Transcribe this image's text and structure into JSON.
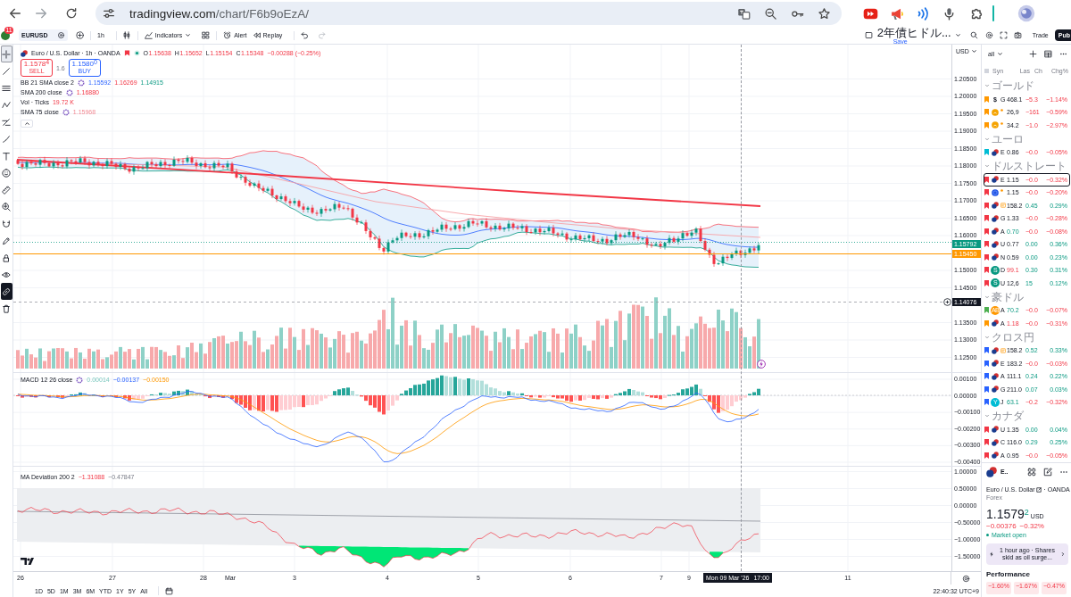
{
  "browser": {
    "url_host": "tradingview.com",
    "url_path": "/chart/F6b9oEzA/"
  },
  "toolbar": {
    "notifications": "11",
    "symbol": "EURUSD",
    "interval": "1h",
    "indicators": "Indicators",
    "alert": "Alert",
    "replay": "Replay",
    "layout_name": "2年債ヒドル...",
    "layout_status": "Save",
    "trade": "Trade",
    "publish": "Pub"
  },
  "drawing_tools": [
    {
      "selected": true,
      "on": false
    },
    {
      "selected": false,
      "on": false
    },
    {
      "selected": false,
      "on": false
    },
    {
      "selected": false,
      "on": false
    },
    {
      "selected": false,
      "on": false
    },
    {
      "selected": false,
      "on": false
    },
    {
      "selected": false,
      "on": false
    },
    {
      "selected": false,
      "on": false
    },
    {
      "selected": false,
      "on": false
    },
    {
      "selected": false,
      "on": false
    },
    {
      "selected": false,
      "on": false
    },
    {
      "selected": false,
      "on": false
    },
    {
      "selected": false,
      "on": false
    },
    {
      "selected": false,
      "on": false
    },
    {
      "selected": false,
      "on": true
    },
    {
      "selected": false,
      "on": false
    }
  ],
  "legend": {
    "title": "Euro / U.S. Dollar · 1h · OANDA",
    "falling": true,
    "ohlc": [
      {
        "label": "O",
        "value": "1.15638"
      },
      {
        "label": "H",
        "value": "1.15652"
      },
      {
        "label": "L",
        "value": "1.15154"
      },
      {
        "label": "C",
        "value": "1.15348"
      }
    ],
    "change": "−0.00288 (−0.25%)",
    "sell": {
      "price": "1.1578$^{4}$",
      "label": "SELL"
    },
    "spread": "1.6",
    "buy": {
      "price": "1.1580$^{0}$",
      "label": "BUY"
    },
    "studies": [
      {
        "kind": "ringed",
        "name": "BB 21 SMA close 2",
        "values": [
          "1.15592",
          "1.16269",
          "1.14915"
        ]
      },
      {
        "kind": "ringed",
        "name": "SMA 200 close",
        "values": [
          "1.16880"
        ]
      },
      {
        "kind": "plain",
        "name": "Vol · Ticks",
        "values": [
          "19.72 K"
        ]
      },
      {
        "kind": "ringed",
        "name": "SMA 75 close",
        "values": [
          "1.15968"
        ]
      }
    ]
  },
  "macd_legend": {
    "kind": "ringed",
    "name": "MACD 12 26 close",
    "values": [
      "0.00014",
      "−0.00137",
      "−0.00150"
    ]
  },
  "deviation_legend": {
    "name": "MA Deviation 200 2",
    "values": [
      "−1.31088",
      "−0.47847"
    ]
  },
  "price_axis": {
    "currency": "USD",
    "ticks": [
      "1.20500",
      "1.20000",
      "1.19500",
      "1.19000",
      "1.18500",
      "1.18000",
      "1.17500",
      "1.17000",
      "1.16500",
      "1.16000",
      "1.15000",
      "1.14500",
      "1.13500",
      "1.13000",
      "1.12500"
    ],
    "markers": [
      {
        "kind": "last",
        "text": "1.15792"
      },
      {
        "kind": "line",
        "text": "1.15450"
      },
      {
        "kind": "crosshair",
        "text": "1.14076"
      }
    ]
  },
  "macd_axis": {
    "ticks": [
      "0.00100",
      "0.00000",
      "−0.00100",
      "−0.00200",
      "−0.00300",
      "−0.00400"
    ]
  },
  "deviation_axis": {
    "ticks": [
      "1.00000",
      "0.50000",
      "0.00000",
      "−0.50000",
      "−1.00000",
      "−1.50000"
    ]
  },
  "time_axis": {
    "ticks": [
      "26",
      "27",
      "28",
      "Mar",
      "3",
      "4",
      "5",
      "6",
      "7",
      "9",
      "11"
    ],
    "crosshair_date": "Mon 09 Mar '26",
    "crosshair_time": "17:00"
  },
  "bottom_bar": {
    "ranges": [
      "1D",
      "5D",
      "1M",
      "3M",
      "6M",
      "YTD",
      "1Y",
      "5Y",
      "All"
    ],
    "clock": "22:40:32 UTC+9"
  },
  "watchlist": {
    "filter": "all",
    "columns": [
      "Syn",
      "Las",
      "Ch",
      "Chg%"
    ],
    "sections": [
      {
        "title": "ゴールド",
        "expanded": true,
        "rows": [
          {
            "color": "#ff9800",
            "icon": {
              "kind": "glyph",
              "text": "$"
            },
            "symbol": "G",
            "last": "468.1",
            "last_rising": false,
            "last_falling": false,
            "change": "−5.3",
            "change_pct": "−1.14%",
            "negative": true,
            "selected": false
          },
          {
            "color": "#ff9800",
            "icon": {
              "kind": "coin"
            },
            "badge": {
              "kind": "dot"
            },
            "last": "26,9",
            "last_rising": false,
            "last_falling": false,
            "change": "−161",
            "change_pct": "−0.59%",
            "negative": true,
            "selected": false
          },
          {
            "color": "#ff9800",
            "icon": {
              "kind": "coin"
            },
            "badge": {
              "kind": "dot"
            },
            "last": "34.2",
            "last_rising": false,
            "last_falling": false,
            "change": "−1.0",
            "change_pct": "−2.97%",
            "negative": true,
            "selected": false
          }
        ]
      },
      {
        "title": "ユーロ",
        "expanded": true,
        "rows": [
          {
            "color": "#00bcd4",
            "icon": {
              "kind": "pair"
            },
            "symbol": "E",
            "last": "0.86",
            "last_rising": false,
            "last_falling": false,
            "change": "−0.0",
            "change_pct": "−0.05%",
            "negative": true,
            "selected": false
          }
        ]
      },
      {
        "title": "ドルストレート",
        "expanded": true,
        "rows": [
          {
            "color": "#f23645",
            "icon": {
              "kind": "pair"
            },
            "symbol": "E",
            "last": "1.15",
            "last_rising": false,
            "last_falling": false,
            "change": "−0.0",
            "change_pct": "−0.32%",
            "negative": true,
            "selected": true
          },
          {
            "color": "#f23645",
            "icon": {
              "kind": "globe"
            },
            "badge": {
              "kind": "dot"
            },
            "last": "1.15",
            "last_rising": false,
            "last_falling": false,
            "change": "−0.0",
            "change_pct": "−0.20%",
            "negative": true,
            "selected": false
          },
          {
            "color": "#f23645",
            "icon": {
              "kind": "pair"
            },
            "badge": {
              "kind": "news"
            },
            "last": "158.2",
            "last_rising": false,
            "last_falling": false,
            "change": "0.45",
            "change_pct": "0.29%",
            "negative": false,
            "selected": false
          },
          {
            "color": "#f23645",
            "icon": {
              "kind": "pair"
            },
            "symbol": "G",
            "last": "1.33",
            "last_rising": false,
            "last_falling": false,
            "change": "−0.0",
            "change_pct": "−0.28%",
            "negative": true,
            "selected": false
          },
          {
            "color": "#f23645",
            "icon": {
              "kind": "pair"
            },
            "symbol": "A",
            "last": "0.70",
            "last_rising": true,
            "last_falling": false,
            "change": "−0.0",
            "change_pct": "−0.08%",
            "negative": true,
            "selected": false
          },
          {
            "color": "#f23645",
            "icon": {
              "kind": "pair"
            },
            "symbol": "U",
            "last": "0.77",
            "last_rising": false,
            "last_falling": false,
            "change": "0.00",
            "change_pct": "0.36%",
            "negative": false,
            "selected": false
          },
          {
            "color": "#f23645",
            "icon": {
              "kind": "pair"
            },
            "symbol": "N",
            "last": "0.59",
            "last_rising": false,
            "last_falling": false,
            "change": "0.00",
            "change_pct": "0.23%",
            "negative": false,
            "selected": false
          },
          {
            "color": "#f23645",
            "icon": {
              "kind": "letter",
              "text": "S",
              "color": "#089981"
            },
            "symbol": "D",
            "last": "99.1",
            "last_rising": false,
            "last_falling": true,
            "change": "0.30",
            "change_pct": "0.31%",
            "negative": false,
            "selected": false
          },
          {
            "color": "#f23645",
            "icon": {
              "kind": "letter",
              "text": "S",
              "color": "#089981"
            },
            "symbol": "U",
            "last": "12,6",
            "last_rising": false,
            "last_falling": false,
            "change": "15",
            "change_pct": "0.12%",
            "negative": false,
            "selected": false
          }
        ]
      },
      {
        "title": "豪ドル",
        "expanded": true,
        "rows": [
          {
            "color": "#4caf50",
            "icon": {
              "kind": "letter",
              "text": "AB",
              "color": "#ff9800"
            },
            "symbol": "A",
            "last": "70.2",
            "last_rising": true,
            "last_falling": false,
            "change": "−0.0",
            "change_pct": "−0.07%",
            "negative": true,
            "selected": false
          },
          {
            "color": "#ff9800",
            "icon": {
              "kind": "pair"
            },
            "symbol": "A",
            "last": "1.18",
            "last_rising": false,
            "last_falling": true,
            "change": "−0.0",
            "change_pct": "−0.31%",
            "negative": true,
            "selected": false
          }
        ]
      },
      {
        "title": "クロス円",
        "expanded": true,
        "rows": [
          {
            "color": "#2962ff",
            "icon": {
              "kind": "pair"
            },
            "badge": {
              "kind": "news"
            },
            "last": "158.2",
            "last_rising": false,
            "last_falling": false,
            "change": "0.52",
            "change_pct": "0.33%",
            "negative": false,
            "selected": false
          },
          {
            "color": "#2962ff",
            "icon": {
              "kind": "pair"
            },
            "symbol": "E",
            "last": "183.2",
            "last_rising": false,
            "last_falling": false,
            "change": "−0.0",
            "change_pct": "−0.03%",
            "negative": true,
            "selected": false
          },
          {
            "color": "#2962ff",
            "icon": {
              "kind": "pair"
            },
            "symbol": "A",
            "last": "111.1",
            "last_rising": false,
            "last_falling": false,
            "change": "0.24",
            "change_pct": "0.22%",
            "negative": false,
            "selected": false
          },
          {
            "color": "#2962ff",
            "icon": {
              "kind": "pair"
            },
            "symbol": "G",
            "last": "211.0",
            "last_rising": false,
            "last_falling": false,
            "change": "0.07",
            "change_pct": "0.03%",
            "negative": false,
            "selected": false
          },
          {
            "color": "#2962ff",
            "icon": {
              "kind": "letter",
              "text": "Y",
              "color": "#00bcd4"
            },
            "symbol": "J",
            "last": "63.1",
            "last_rising": true,
            "last_falling": false,
            "change": "−0.2",
            "change_pct": "−0.32%",
            "negative": true,
            "selected": false
          }
        ]
      },
      {
        "title": "カナダ",
        "expanded": true,
        "rows": [
          {
            "color": "#f23645",
            "icon": {
              "kind": "pair"
            },
            "symbol": "U",
            "last": "1.35",
            "last_rising": false,
            "last_falling": false,
            "change": "0.00",
            "change_pct": "0.04%",
            "negative": false,
            "selected": false
          },
          {
            "color": "#f23645",
            "icon": {
              "kind": "pair"
            },
            "symbol": "C",
            "last": "116.0",
            "last_rising": false,
            "last_falling": false,
            "change": "0.29",
            "change_pct": "0.25%",
            "negative": false,
            "selected": false
          },
          {
            "color": "#f23645",
            "icon": {
              "kind": "pair"
            },
            "symbol": "A",
            "last": "0.95",
            "last_rising": false,
            "last_falling": false,
            "change": "−0.0",
            "change_pct": "−0.05%",
            "negative": true,
            "selected": false
          }
        ]
      }
    ]
  },
  "details": {
    "symbol": "E..",
    "name": "Euro / U.S. Dollar",
    "exchange": "· OANDA",
    "type": "Forex",
    "price": "1.1579",
    "price_fraction": "2",
    "price_rising": true,
    "currency": "USD",
    "change": "−0.00376",
    "change_pct": "−0.32%",
    "negative": true,
    "status": "Market open",
    "news": "1 hour ago · Shares skid as oil surge...",
    "performance_title": "Performance",
    "performance": [
      "−1.60%",
      "−1.67%",
      "−0.47%"
    ]
  }
}
